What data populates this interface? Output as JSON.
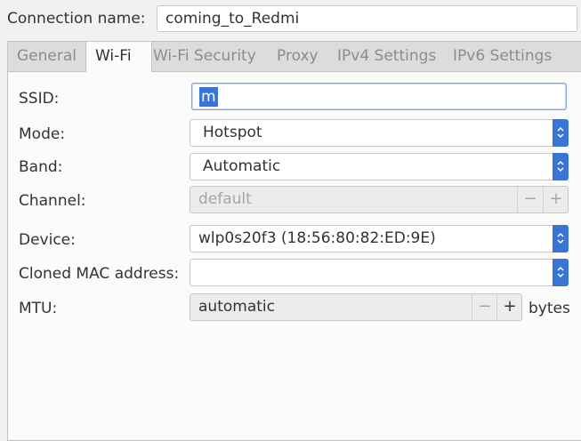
{
  "connection": {
    "label": "Connection name:",
    "value": "coming_to_Redmi"
  },
  "tabs": [
    {
      "label": "General"
    },
    {
      "label": "Wi-Fi"
    },
    {
      "label": "Wi-Fi Security"
    },
    {
      "label": "Proxy"
    },
    {
      "label": "IPv4 Settings"
    },
    {
      "label": "IPv6 Settings"
    }
  ],
  "active_tab": "Wi-Fi",
  "wifi": {
    "ssid": {
      "label": "SSID:",
      "value": "m"
    },
    "mode": {
      "label": "Mode:",
      "value": "Hotspot"
    },
    "band": {
      "label": "Band:",
      "value": "Automatic"
    },
    "channel": {
      "label": "Channel:",
      "value": "default",
      "minus": "−",
      "plus": "+"
    },
    "device": {
      "label": "Device:",
      "value": "wlp0s20f3 (18:56:80:82:ED:9E)"
    },
    "cloned_mac": {
      "label": "Cloned MAC address:",
      "value": ""
    },
    "mtu": {
      "label": "MTU:",
      "value": "automatic",
      "minus": "−",
      "plus": "+",
      "unit": "bytes"
    }
  },
  "colors": {
    "accent": "#3875d7",
    "window_bg": "#f2f1f0",
    "tab_bg": "#dcdcda"
  }
}
